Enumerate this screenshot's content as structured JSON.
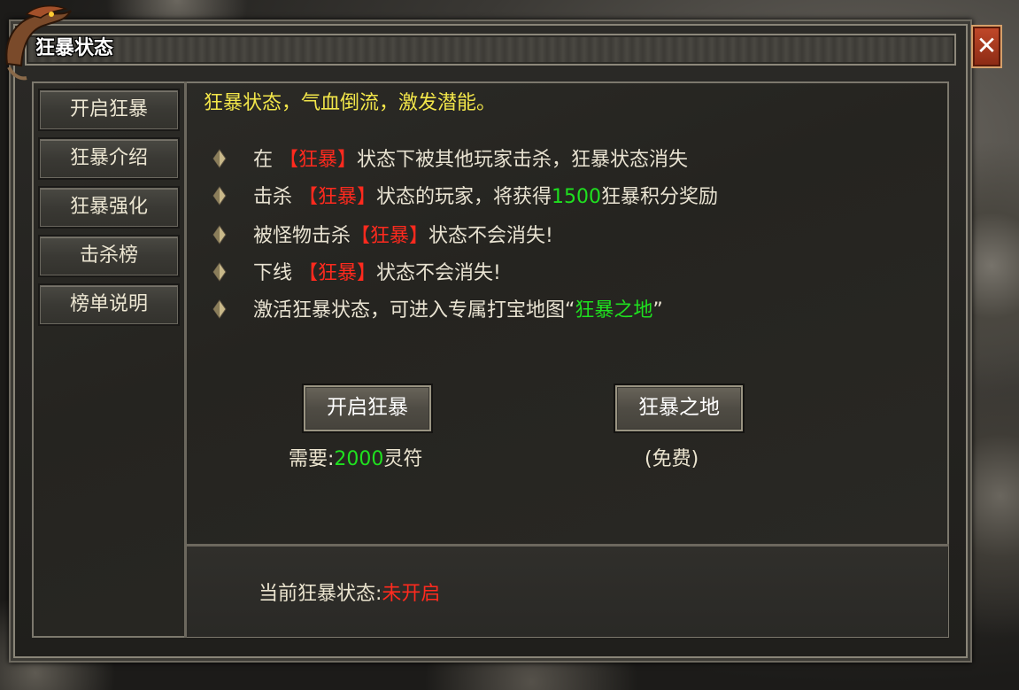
{
  "window": {
    "title": "狂暴状态",
    "close_label": "✕"
  },
  "sidebar": {
    "items": [
      {
        "label": "开启狂暴"
      },
      {
        "label": "狂暴介绍"
      },
      {
        "label": "狂暴强化"
      },
      {
        "label": "击杀榜"
      },
      {
        "label": "榜单说明"
      }
    ]
  },
  "content": {
    "intro": "狂暴状态，气血倒流，激发潜能。",
    "rules": [
      {
        "pre": "在 ",
        "tag": "【狂暴】",
        "post": "状态下被其他玩家击杀，狂暴状态消失"
      },
      {
        "pre": "击杀 ",
        "tag": "【狂暴】",
        "mid": "状态的玩家，将获得",
        "num": "1500",
        "post": "狂暴积分奖励"
      },
      {
        "pre": "被怪物击杀",
        "tag": "【狂暴】",
        "post": "状态不会消失!"
      },
      {
        "pre": "下线 ",
        "tag": "【狂暴】",
        "post": "状态不会消失!"
      },
      {
        "pre": "激活狂暴状态，可进入专属打宝地图“",
        "place": "狂暴之地",
        "post": "”"
      }
    ],
    "bullet_icon": "diamond-bullet-icon"
  },
  "actions": {
    "activate": {
      "label": "开启狂暴",
      "cost_prefix": "需要:",
      "cost_value": "2000",
      "cost_suffix": "灵符"
    },
    "berserk_land": {
      "label": "狂暴之地",
      "note": "(免费)"
    }
  },
  "status": {
    "label": "当前狂暴状态:",
    "value": "未开启"
  },
  "colors": {
    "highlight_yellow": "#f2e64a",
    "tag_red": "#ff2a1e",
    "number_green": "#1fe01f",
    "close_red": "#b23a1f"
  }
}
